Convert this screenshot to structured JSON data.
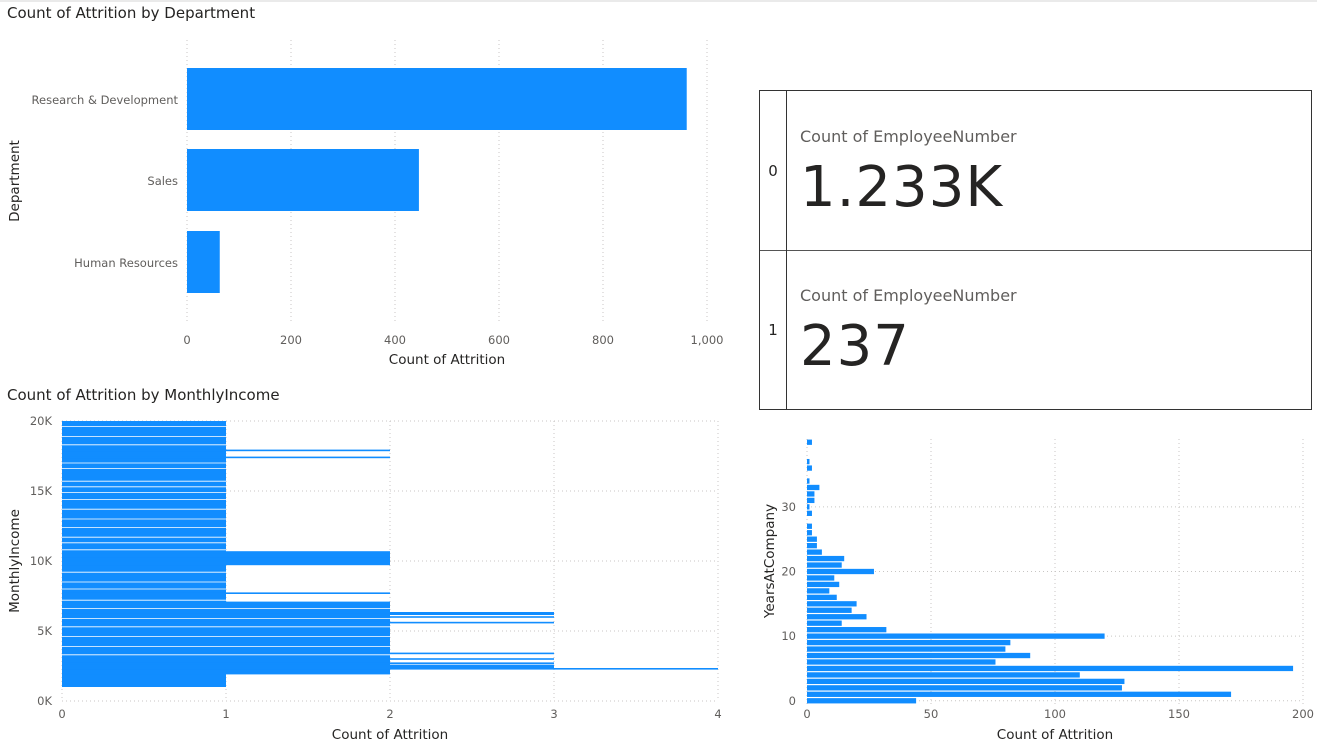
{
  "titles": {
    "dept": "Count of Attrition by Department",
    "income": "Count of Attrition by MonthlyIncome"
  },
  "card": {
    "rows": [
      {
        "key": "0",
        "caption": "Count of EmployeeNumber",
        "value": "1.233K"
      },
      {
        "key": "1",
        "caption": "Count of EmployeeNumber",
        "value": "237"
      }
    ]
  },
  "chart_data": [
    {
      "type": "bar",
      "orientation": "horizontal",
      "title": "Count of Attrition by Department",
      "xlabel": "Count of Attrition",
      "ylabel": "Department",
      "categories": [
        "Research & Development",
        "Sales",
        "Human Resources"
      ],
      "values": [
        961,
        446,
        63
      ],
      "xlim": [
        0,
        1000
      ],
      "xticks": [
        0,
        200,
        400,
        600,
        800,
        1000
      ],
      "xtick_labels": [
        "0",
        "200",
        "400",
        "600",
        "800",
        "1,000"
      ],
      "grid": true
    },
    {
      "type": "bar",
      "orientation": "horizontal",
      "title": "Count of Attrition by MonthlyIncome",
      "xlabel": "Count of Attrition",
      "ylabel": "MonthlyIncome",
      "xlim": [
        0,
        4
      ],
      "ylim": [
        0,
        20000
      ],
      "xticks": [
        0,
        1,
        2,
        3,
        4
      ],
      "yticks": [
        0,
        5000,
        10000,
        15000,
        20000
      ],
      "ytick_labels": [
        "0K",
        "5K",
        "10K",
        "15K",
        "20K"
      ],
      "segments": [
        {
          "y_from": 1000,
          "y_to": 19999,
          "value": 1
        },
        {
          "y_from": 1900,
          "y_to": 7100,
          "value": 2
        },
        {
          "y_from": 9700,
          "y_to": 10700,
          "value": 2
        },
        {
          "y_from": 2300,
          "y_to": 2600,
          "value": 3
        }
      ],
      "lines": [
        {
          "y": 17400,
          "value": 2
        },
        {
          "y": 17900,
          "value": 2
        },
        {
          "y": 10600,
          "value": 2
        },
        {
          "y": 10200,
          "value": 2
        },
        {
          "y": 10000,
          "value": 2
        },
        {
          "y": 7700,
          "value": 2
        },
        {
          "y": 7000,
          "value": 2
        },
        {
          "y": 6300,
          "value": 3
        },
        {
          "y": 6200,
          "value": 3
        },
        {
          "y": 6000,
          "value": 3
        },
        {
          "y": 5600,
          "value": 3
        },
        {
          "y": 3400,
          "value": 3
        },
        {
          "y": 3000,
          "value": 3
        },
        {
          "y": 2700,
          "value": 3
        },
        {
          "y": 2300,
          "value": 4
        }
      ],
      "grid": true
    },
    {
      "type": "bar",
      "orientation": "horizontal",
      "title": "",
      "xlabel": "Count of Attrition",
      "ylabel": "YearsAtCompany",
      "categories": [
        0,
        1,
        2,
        3,
        4,
        5,
        6,
        7,
        8,
        9,
        10,
        11,
        12,
        13,
        14,
        15,
        16,
        17,
        18,
        19,
        20,
        21,
        22,
        23,
        24,
        25,
        26,
        27,
        29,
        30,
        31,
        32,
        33,
        34,
        36,
        37,
        40
      ],
      "values": [
        44,
        171,
        127,
        128,
        110,
        196,
        76,
        90,
        80,
        82,
        120,
        32,
        14,
        24,
        18,
        20,
        12,
        9,
        13,
        11,
        27,
        14,
        15,
        6,
        4,
        4,
        2,
        2,
        2,
        1,
        3,
        3,
        5,
        1,
        2,
        1,
        2
      ],
      "xlim": [
        0,
        200
      ],
      "ylim": [
        -0.5,
        40.5
      ],
      "xticks": [
        0,
        50,
        100,
        150,
        200
      ],
      "yticks": [
        0,
        10,
        20,
        30
      ],
      "grid": true
    }
  ]
}
